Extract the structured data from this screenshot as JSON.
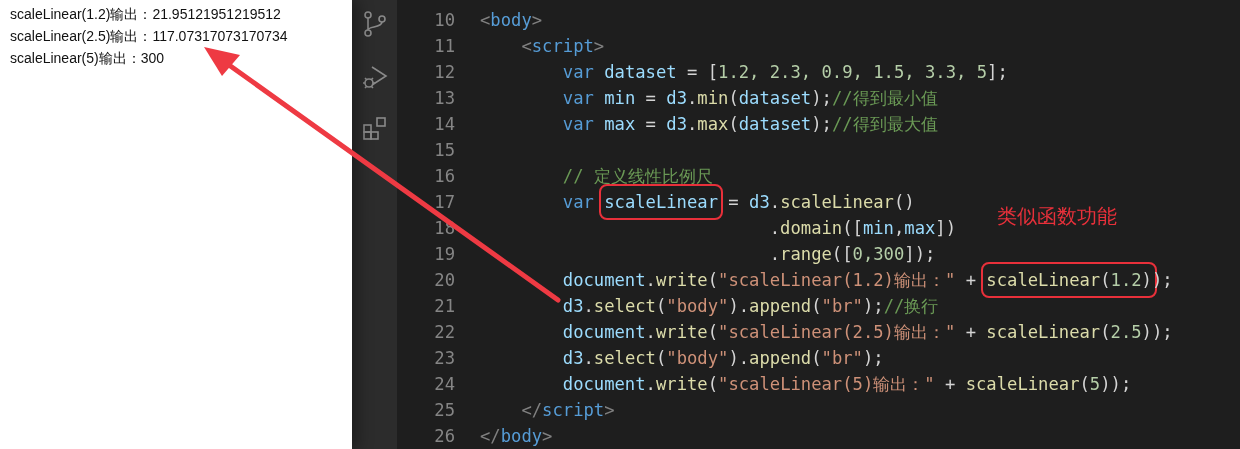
{
  "browser_output": {
    "lines": [
      "scaleLinear(1.2)输出：21.95121951219512",
      "scaleLinear(2.5)输出：117.07317073170734",
      "scaleLinear(5)输出：300"
    ]
  },
  "editor": {
    "lines": [
      {
        "number": "10",
        "tokens": [
          {
            "kind": "bracket",
            "text": "<"
          },
          {
            "kind": "tag",
            "text": "body"
          },
          {
            "kind": "bracket",
            "text": ">"
          }
        ]
      },
      {
        "number": "11",
        "tokens": [
          {
            "kind": "bracket",
            "text": "    <"
          },
          {
            "kind": "tag",
            "text": "script"
          },
          {
            "kind": "bracket",
            "text": ">"
          }
        ]
      },
      {
        "number": "12",
        "tokens": [
          {
            "kind": "keyword",
            "text": "        var "
          },
          {
            "kind": "ident",
            "text": "dataset"
          },
          {
            "kind": "punct",
            "text": " = ["
          },
          {
            "kind": "number",
            "text": "1.2, 2.3, 0.9, 1.5, 3.3, 5"
          },
          {
            "kind": "punct",
            "text": "];"
          }
        ]
      },
      {
        "number": "13",
        "tokens": [
          {
            "kind": "keyword",
            "text": "        var "
          },
          {
            "kind": "ident",
            "text": "min"
          },
          {
            "kind": "punct",
            "text": " = "
          },
          {
            "kind": "ident",
            "text": "d3"
          },
          {
            "kind": "punct",
            "text": "."
          },
          {
            "kind": "func",
            "text": "min"
          },
          {
            "kind": "punct",
            "text": "("
          },
          {
            "kind": "ident",
            "text": "dataset"
          },
          {
            "kind": "punct",
            "text": ");"
          },
          {
            "kind": "comment",
            "text": "//得到最小值"
          }
        ]
      },
      {
        "number": "14",
        "tokens": [
          {
            "kind": "keyword",
            "text": "        var "
          },
          {
            "kind": "ident",
            "text": "max"
          },
          {
            "kind": "punct",
            "text": " = "
          },
          {
            "kind": "ident",
            "text": "d3"
          },
          {
            "kind": "punct",
            "text": "."
          },
          {
            "kind": "func",
            "text": "max"
          },
          {
            "kind": "punct",
            "text": "("
          },
          {
            "kind": "ident",
            "text": "dataset"
          },
          {
            "kind": "punct",
            "text": ");"
          },
          {
            "kind": "comment",
            "text": "//得到最大值"
          }
        ]
      },
      {
        "number": "15"
      },
      {
        "number": "16",
        "tokens": [
          {
            "kind": "comment",
            "text": "        // 定义线性比例尺"
          }
        ]
      },
      {
        "number": "17",
        "tokens": [
          {
            "kind": "keyword",
            "text": "        var "
          },
          {
            "kind": "group",
            "boxed": true,
            "tokens": [
              {
                "kind": "ident",
                "text": "scaleLinear"
              }
            ]
          },
          {
            "kind": "punct",
            "text": " = "
          },
          {
            "kind": "ident",
            "text": "d3"
          },
          {
            "kind": "punct",
            "text": "."
          },
          {
            "kind": "func",
            "text": "scaleLinear"
          },
          {
            "kind": "punct",
            "text": "()"
          }
        ]
      },
      {
        "number": "18",
        "tokens": [
          {
            "kind": "punct",
            "text": "                            ."
          },
          {
            "kind": "func",
            "text": "domain"
          },
          {
            "kind": "punct",
            "text": "(["
          },
          {
            "kind": "ident",
            "text": "min"
          },
          {
            "kind": "punct",
            "text": ","
          },
          {
            "kind": "ident",
            "text": "max"
          },
          {
            "kind": "punct",
            "text": "])"
          }
        ]
      },
      {
        "number": "19",
        "tokens": [
          {
            "kind": "punct",
            "text": "                            ."
          },
          {
            "kind": "func",
            "text": "range"
          },
          {
            "kind": "punct",
            "text": "(["
          },
          {
            "kind": "number",
            "text": "0,300"
          },
          {
            "kind": "punct",
            "text": "]);"
          }
        ]
      },
      {
        "number": "20",
        "tokens": [
          {
            "kind": "ident",
            "text": "        document"
          },
          {
            "kind": "punct",
            "text": "."
          },
          {
            "kind": "func",
            "text": "write"
          },
          {
            "kind": "punct",
            "text": "("
          },
          {
            "kind": "string",
            "text": "\"scaleLinear(1.2)输出：\""
          },
          {
            "kind": "punct",
            "text": " + "
          },
          {
            "kind": "group",
            "boxed": true,
            "tokens": [
              {
                "kind": "func",
                "text": "scaleLinear"
              },
              {
                "kind": "punct",
                "text": "("
              },
              {
                "kind": "number",
                "text": "1.2"
              },
              {
                "kind": "punct",
                "text": ")"
              }
            ]
          },
          {
            "kind": "punct",
            "text": ");"
          }
        ]
      },
      {
        "number": "21",
        "tokens": [
          {
            "kind": "ident",
            "text": "        d3"
          },
          {
            "kind": "punct",
            "text": "."
          },
          {
            "kind": "func",
            "text": "select"
          },
          {
            "kind": "punct",
            "text": "("
          },
          {
            "kind": "string",
            "text": "\"body\""
          },
          {
            "kind": "punct",
            "text": ")."
          },
          {
            "kind": "func",
            "text": "append"
          },
          {
            "kind": "punct",
            "text": "("
          },
          {
            "kind": "string",
            "text": "\"br\""
          },
          {
            "kind": "punct",
            "text": ");"
          },
          {
            "kind": "comment",
            "text": "//换行"
          }
        ]
      },
      {
        "number": "22",
        "tokens": [
          {
            "kind": "ident",
            "text": "        document"
          },
          {
            "kind": "punct",
            "text": "."
          },
          {
            "kind": "func",
            "text": "write"
          },
          {
            "kind": "punct",
            "text": "("
          },
          {
            "kind": "string",
            "text": "\"scaleLinear(2.5)输出：\""
          },
          {
            "kind": "punct",
            "text": " + "
          },
          {
            "kind": "func",
            "text": "scaleLinear"
          },
          {
            "kind": "punct",
            "text": "("
          },
          {
            "kind": "number",
            "text": "2.5"
          },
          {
            "kind": "punct",
            "text": "));"
          }
        ]
      },
      {
        "number": "23",
        "tokens": [
          {
            "kind": "ident",
            "text": "        d3"
          },
          {
            "kind": "punct",
            "text": "."
          },
          {
            "kind": "func",
            "text": "select"
          },
          {
            "kind": "punct",
            "text": "("
          },
          {
            "kind": "string",
            "text": "\"body\""
          },
          {
            "kind": "punct",
            "text": ")."
          },
          {
            "kind": "func",
            "text": "append"
          },
          {
            "kind": "punct",
            "text": "("
          },
          {
            "kind": "string",
            "text": "\"br\""
          },
          {
            "kind": "punct",
            "text": ");"
          }
        ]
      },
      {
        "number": "24",
        "tokens": [
          {
            "kind": "ident",
            "text": "        document"
          },
          {
            "kind": "punct",
            "text": "."
          },
          {
            "kind": "func",
            "text": "write"
          },
          {
            "kind": "punct",
            "text": "("
          },
          {
            "kind": "string",
            "text": "\"scaleLinear(5)输出：\""
          },
          {
            "kind": "punct",
            "text": " + "
          },
          {
            "kind": "func",
            "text": "scaleLinear"
          },
          {
            "kind": "punct",
            "text": "("
          },
          {
            "kind": "number",
            "text": "5"
          },
          {
            "kind": "punct",
            "text": "));"
          }
        ]
      },
      {
        "number": "25",
        "tokens": [
          {
            "kind": "bracket",
            "text": "    </"
          },
          {
            "kind": "tag",
            "text": "script"
          },
          {
            "kind": "bracket",
            "text": ">"
          }
        ]
      },
      {
        "number": "26",
        "tokens": [
          {
            "kind": "bracket",
            "text": "</"
          },
          {
            "kind": "tag",
            "text": "body"
          },
          {
            "kind": "bracket",
            "text": ">"
          }
        ]
      }
    ]
  },
  "annotation": {
    "text": "类似函数功能"
  }
}
